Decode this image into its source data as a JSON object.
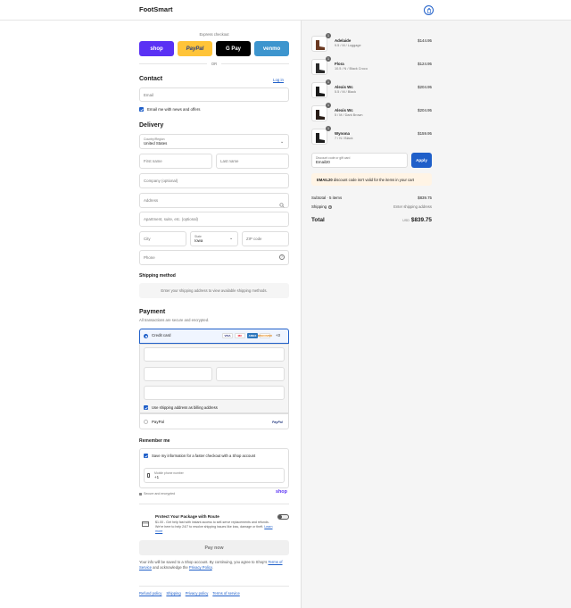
{
  "header": {
    "brand": "FootSmart",
    "cart_icon": "shopping-bag-icon"
  },
  "express": {
    "title": "Express checkout",
    "buttons": [
      {
        "label": "shop",
        "color": "#5a31f4"
      },
      {
        "label": "PayPal",
        "color": "#ffc439"
      },
      {
        "label": "G Pay",
        "color": "#000000"
      },
      {
        "label": "venmo",
        "color": "#3d95ce"
      }
    ],
    "or_label": "OR"
  },
  "contact": {
    "title": "Contact",
    "login_link": "Log in",
    "email_placeholder": "Email",
    "news_label": "Email me with news and offers"
  },
  "delivery": {
    "title": "Delivery",
    "country_label": "Country/Region",
    "country_value": "United States",
    "first_name": "First name",
    "last_name": "Last name",
    "company": "Company (optional)",
    "address": "Address",
    "apartment": "Apartment, suite, etc. (optional)",
    "city": "City",
    "state_label": "State",
    "state_value": "Iowa",
    "zip": "ZIP code",
    "phone": "Phone"
  },
  "shipping": {
    "title": "Shipping method",
    "message": "Enter your shipping address to view available shipping methods."
  },
  "payment": {
    "title": "Payment",
    "subtitle": "All transactions are secure and encrypted.",
    "credit_card_label": "Credit card",
    "card_brands": [
      "VISA",
      "MC",
      "AMEX",
      "DISCOVER"
    ],
    "more_label": "+3",
    "billing_label": "Use shipping address as billing address",
    "paypal_label": "PayPal",
    "paypal_logo": "PayPal"
  },
  "remember": {
    "title": "Remember me",
    "save_label": "Save my information for a faster checkout with a Shop account",
    "mobile_label": "Mobile phone number",
    "mobile_value": "+1",
    "secure_label": "Secure and encrypted",
    "shop_logo": "shop"
  },
  "route": {
    "title": "Protect Your Package with Route",
    "text": "$1.00 - Get help fast with instant access to self-serve replacements and refunds. We're here to help 24/7 to resolve shipping issues like loss, damage or theft.",
    "learn_more": "Learn more"
  },
  "pay_now": "Pay now",
  "terms": {
    "text_before": "Your info will be saved to a Shop account. By continuing, you agree to Shop's",
    "terms_link": "Terms of Service",
    "middle": "and acknowledge the",
    "privacy_link": "Privacy Policy",
    "end": "."
  },
  "footer_links": [
    "Refund policy",
    "Shipping",
    "Privacy policy",
    "Terms of service"
  ],
  "cart": {
    "items": [
      {
        "name": "Adelaide",
        "variant": "9.5 / M / Luggage",
        "price": "$144.95",
        "qty": "1",
        "shoe_color": "#6b3a22"
      },
      {
        "name": "Flora",
        "variant": "10.5 / N / Black Croco",
        "price": "$124.95",
        "qty": "1",
        "shoe_color": "#2b2b2b"
      },
      {
        "name": "Alexis Wc",
        "variant": "5.5 / M / Black",
        "price": "$204.95",
        "qty": "1",
        "shoe_color": "#1b1b1b"
      },
      {
        "name": "Alexis Wc",
        "variant": "5 / M / Dark Brown",
        "price": "$204.95",
        "qty": "1",
        "shoe_color": "#2a1e18"
      },
      {
        "name": "Wynona",
        "variant": "7 / N / Black",
        "price": "$159.95",
        "qty": "1",
        "shoe_color": "#1e1e1e"
      }
    ],
    "discount_label": "Discount code or gift card",
    "discount_value": "Email20",
    "apply_label": "Apply",
    "warning_code": "EMAIL20",
    "warning_text": "discount code isn't valid for the items in your cart",
    "subtotal_label": "Subtotal · 5 items",
    "subtotal_value": "$839.75",
    "shipping_label": "Shipping",
    "shipping_value": "Enter shipping address",
    "total_label": "Total",
    "currency": "USD",
    "total_value": "$839.75"
  }
}
